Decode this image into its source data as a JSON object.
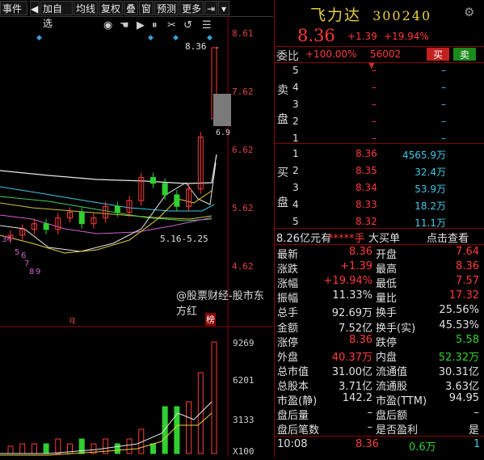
{
  "toolbar": {
    "items": [
      "事件",
      "加自选",
      "均线",
      "复权",
      "叠",
      "窗",
      "预测",
      "更多"
    ]
  },
  "chart": {
    "price_labels": [
      "8.61",
      "7.62",
      "6.62",
      "5.62",
      "4.62"
    ],
    "high_label": "8.36",
    "low_marker": "6.9",
    "range_label": "5.16-5.25",
    "bottom_left_digits": [
      "34",
      "5",
      "6",
      "7",
      "8",
      "9"
    ],
    "q_label": "q",
    "bang_label": "榜",
    "volume_labels": [
      "9269",
      "6201",
      "3133",
      "X100"
    ],
    "watermark": "@股票财经-股市东方红",
    "tools": [
      "eye-icon",
      "hand-icon",
      "play-icon",
      "pause-icon",
      "scissors-icon",
      "undo-icon",
      "menu-icon"
    ]
  },
  "chart_data": [
    {
      "type": "line",
      "title": "",
      "ylim": [
        4.5,
        8.7
      ],
      "series": [
        {
          "values": [
            5.2,
            5.3,
            5.4,
            5.3,
            5.5,
            5.6,
            5.4,
            5.5,
            5.7,
            5.6,
            5.8,
            6.2,
            6.1,
            5.9,
            5.7,
            6.0,
            6.9,
            8.36
          ]
        }
      ]
    }
  ],
  "quote": {
    "name": "飞力达",
    "code": "300240",
    "price": "8.36",
    "change": "+1.39",
    "change_pct": "+19.94%"
  },
  "orderbook": {
    "weibi_label": "委比",
    "weibi_value": "+100.00%",
    "weicha_value": "56002",
    "sell_btn": "买",
    "buy_btn": "卖",
    "sell_side_label": [
      "卖",
      "盘"
    ],
    "buy_side_label": [
      "买",
      "盘"
    ],
    "sell": [
      {
        "level": "5",
        "price": "–",
        "vol": "–"
      },
      {
        "level": "4",
        "price": "–",
        "vol": "–"
      },
      {
        "level": "3",
        "price": "–",
        "vol": "–"
      },
      {
        "level": "2",
        "price": "–",
        "vol": "–"
      },
      {
        "level": "1",
        "price": "–",
        "vol": "–"
      }
    ],
    "buy": [
      {
        "level": "1",
        "price": "8.36",
        "vol": "4565.9万"
      },
      {
        "level": "2",
        "price": "8.35",
        "vol": "32.4万"
      },
      {
        "level": "3",
        "price": "8.34",
        "vol": "53.9万"
      },
      {
        "level": "4",
        "price": "8.33",
        "vol": "18.2万"
      },
      {
        "level": "5",
        "price": "8.32",
        "vol": "11.1万"
      }
    ]
  },
  "bigorder": {
    "prefix": "8.26亿元有",
    "stars": "*****手",
    "label": "大买单",
    "link": "点击查看"
  },
  "stats": [
    {
      "l1": "最新",
      "v1": "8.36",
      "c1": "red",
      "l2": "开盘",
      "v2": "7.64",
      "c2": "red"
    },
    {
      "l1": "涨跌",
      "v1": "+1.39",
      "c1": "red",
      "l2": "最高",
      "v2": "8.36",
      "c2": "red"
    },
    {
      "l1": "涨幅",
      "v1": "+19.94%",
      "c1": "red",
      "l2": "最低",
      "v2": "7.57",
      "c2": "red"
    },
    {
      "l1": "振幅",
      "v1": "11.33%",
      "c1": "white",
      "l2": "量比",
      "v2": "17.32",
      "c2": "red"
    },
    {
      "l1": "总手",
      "v1": "92.69万",
      "c1": "white",
      "l2": "换手",
      "v2": "25.56%",
      "c2": "white"
    },
    {
      "l1": "金额",
      "v1": "7.52亿",
      "c1": "white",
      "l2": "换手(实)",
      "v2": "45.53%",
      "c2": "white"
    },
    {
      "l1": "涨停",
      "v1": "8.36",
      "c1": "red",
      "l2": "跌停",
      "v2": "5.58",
      "c2": "green"
    },
    {
      "l1": "外盘",
      "v1": "40.37万",
      "c1": "red",
      "l2": "内盘",
      "v2": "52.32万",
      "c2": "green"
    },
    {
      "l1": "总市值",
      "v1": "31.00亿",
      "c1": "white",
      "l2": "流通值",
      "v2": "30.31亿",
      "c2": "white"
    },
    {
      "l1": "总股本",
      "v1": "3.71亿",
      "c1": "white",
      "l2": "流通股",
      "v2": "3.63亿",
      "c2": "white"
    },
    {
      "l1": "市盈(静)",
      "v1": "142.2",
      "c1": "white",
      "l2": "市盈(TTM)",
      "v2": "94.95",
      "c2": "white"
    },
    {
      "l1": "盘后量",
      "v1": "–",
      "c1": "white",
      "l2": "盘后额",
      "v2": "–",
      "c2": "white"
    },
    {
      "l1": "盘后笔数",
      "v1": "–",
      "c1": "white",
      "l2": "是否盈利",
      "v2": "是",
      "c2": "white"
    }
  ],
  "tick": {
    "time": "10:08",
    "price": "8.36",
    "vol": "0.6万",
    "count": "1"
  },
  "colors": {
    "up": "#ff3a3a",
    "down": "#2fd02f",
    "title": "#e8d040",
    "border": "#8a0000"
  }
}
